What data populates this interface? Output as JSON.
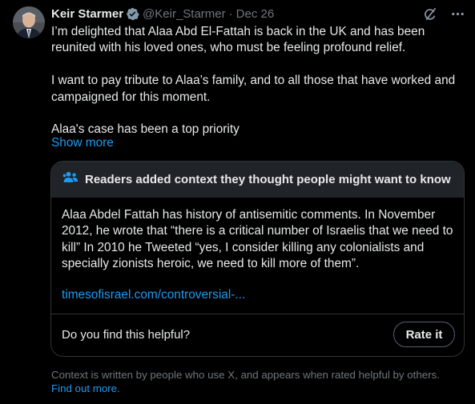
{
  "tweet": {
    "author_name": "Keir Starmer",
    "handle": "@Keir_Starmer",
    "separator": "·",
    "date": "Dec 26",
    "text": "I’m delighted that Alaa Abd El-Fattah is back in the UK and has been reunited with his loved ones, who must be feeling profound relief.\n\nI want to pay tribute to Alaa’s family, and to all those that have worked and campaigned for this moment.\n\nAlaa's case has been a top priority",
    "show_more": "Show more"
  },
  "community_note": {
    "header": "Readers added context they thought people might want to know",
    "body": "Alaa Abdel Fattah has history of antisemitic comments. In November 2012, he wrote that “there is a critical number of Israelis that we need to kill” In 2010 he Tweeted “yes, I consider killing any colonialists and specially zionists heroic, we need to kill more of them”.",
    "link": "timesofisrael.com/controversial-...",
    "helpful_question": "Do you find this helpful?",
    "rate_button": "Rate it"
  },
  "footer": {
    "text": "Context is written by people who use X, and appears when rated helpful by others.",
    "link": "Find out more."
  },
  "icons": {
    "verified": "verified-badge-icon",
    "grok": "grok-icon",
    "more": "more-icon",
    "people": "people-icon"
  },
  "colors": {
    "background": "#000000",
    "text": "#e7e9ea",
    "muted": "#71767b",
    "accent": "#1d9bf0",
    "border": "#2f3336",
    "note_header_bg": "#202327"
  }
}
